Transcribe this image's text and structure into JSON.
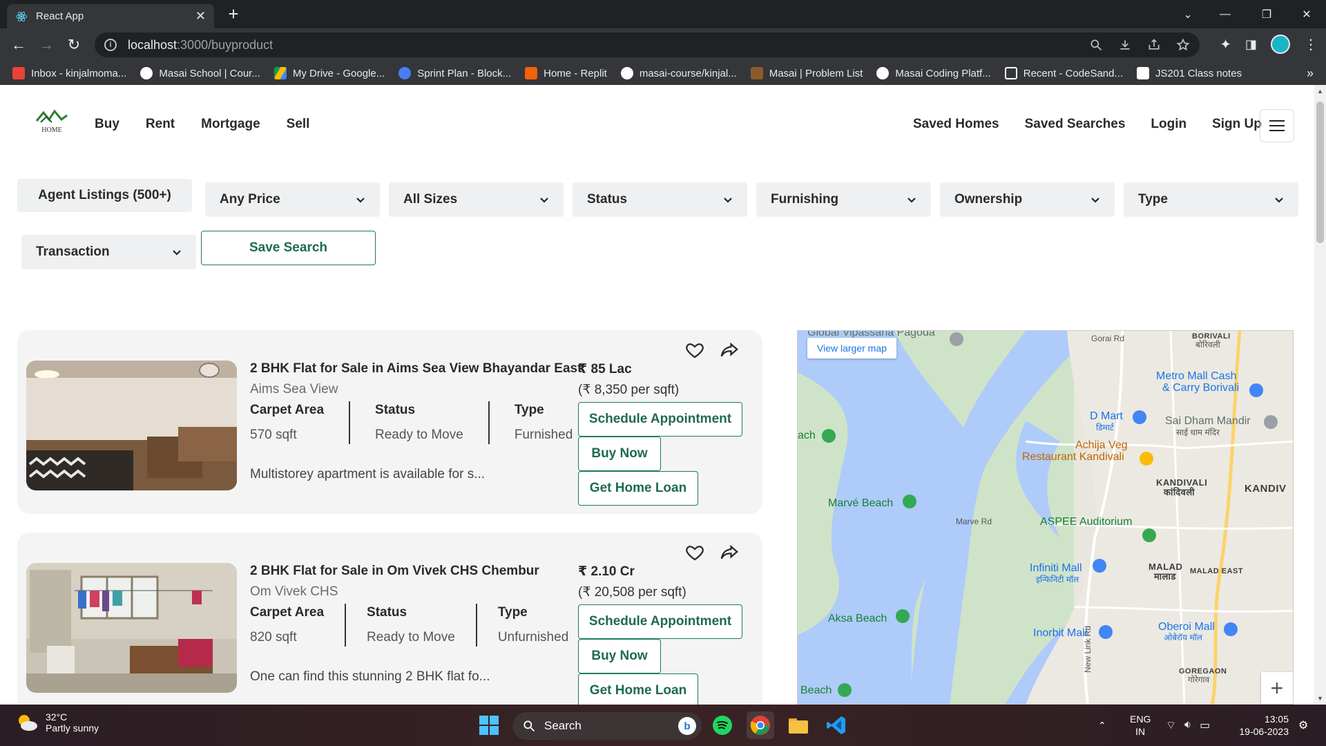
{
  "browser": {
    "tab_title": "React App",
    "url_host": "localhost",
    "url_path": ":3000/buyproduct",
    "bookmarks": [
      {
        "label": "Inbox - kinjalmoma...",
        "color": "#ea4335"
      },
      {
        "label": "Masai School | Cour...",
        "color": "#ffffff"
      },
      {
        "label": "My Drive - Google...",
        "color": "#fbbc04"
      },
      {
        "label": "Sprint Plan - Block...",
        "color": "#4a7cf7"
      },
      {
        "label": "Home - Replit",
        "color": "#f26207"
      },
      {
        "label": "masai-course/kinjal...",
        "color": "#ffffff"
      },
      {
        "label": "Masai | Problem List",
        "color": "#8b5a2b"
      },
      {
        "label": "Masai Coding Platf...",
        "color": "#ffffff"
      },
      {
        "label": "Recent - CodeSand...",
        "color": "#ffffff"
      },
      {
        "label": "JS201 Class notes",
        "color": "#ffffff"
      }
    ]
  },
  "header": {
    "logo_text": "HOME",
    "nav": [
      "Buy",
      "Rent",
      "Mortgage",
      "Sell"
    ],
    "right_nav": [
      "Saved Homes",
      "Saved Searches",
      "Login",
      "Sign Up"
    ]
  },
  "filters": {
    "agent_listings": "Agent Listings (500+)",
    "dropdowns": [
      "Any Price",
      "All Sizes",
      "Status",
      "Furnishing",
      "Ownership",
      "Type"
    ],
    "transaction": "Transaction",
    "save_search": "Save Search"
  },
  "listings": [
    {
      "title": "2 BHK Flat for Sale in Aims Sea View Bhayandar East",
      "project": "Aims Sea View",
      "stats": [
        {
          "label": "Carpet Area",
          "value": "570 sqft"
        },
        {
          "label": "Status",
          "value": "Ready to Move"
        },
        {
          "label": "Type",
          "value": "Furnished"
        }
      ],
      "description": "Multistorey apartment is available for s...",
      "price": "₹ 85 Lac",
      "price_per_sqft": "(₹ 8,350 per sqft)"
    },
    {
      "title": "2 BHK Flat for Sale in Om Vivek CHS Chembur",
      "project": "Om Vivek CHS",
      "stats": [
        {
          "label": "Carpet Area",
          "value": "820 sqft"
        },
        {
          "label": "Status",
          "value": "Ready to Move"
        },
        {
          "label": "Type",
          "value": "Unfurnished"
        }
      ],
      "description": "One can find this stunning 2 BHK flat fo...",
      "price": "₹ 2.10 Cr",
      "price_per_sqft": "(₹ 20,508 per sqft)"
    }
  ],
  "listing_buttons": {
    "schedule": "Schedule Appointment",
    "buy": "Buy Now",
    "loan": "Get Home Loan"
  },
  "map": {
    "view_larger": "View larger map",
    "labels": [
      "Global Vipassana Pagoda",
      "Gorai Rd",
      "BORIVALI",
      "बोरिवली",
      "Metro Mall Cash",
      "& Carry Borivali",
      "D Mart",
      "डिमार्ट",
      "Sai Dham Mandir",
      "साई धाम मंदिर",
      "Achija Veg",
      "Restaurant Kandivali",
      "KANDIVALI",
      "कांदिवली",
      "KANDIV",
      "Marvé Beach",
      "Marve Rd",
      "ASPEE Auditorium",
      "Infiniti Mall",
      "इन्फिनिटी मॉल",
      "MALAD",
      "मालाड",
      "MALAD EAST",
      "Aksa Beach",
      "Inorbit Mall",
      "Oberoi Mall",
      "ओबेरॉय मॉल",
      "New Link Rd",
      "GOREGAON",
      "गोरेगाव",
      "Beach",
      "ach"
    ]
  },
  "taskbar": {
    "temperature": "32°C",
    "weather": "Partly sunny",
    "search": "Search",
    "lang1": "ENG",
    "lang2": "IN",
    "time": "13:05",
    "date": "19-06-2023"
  }
}
